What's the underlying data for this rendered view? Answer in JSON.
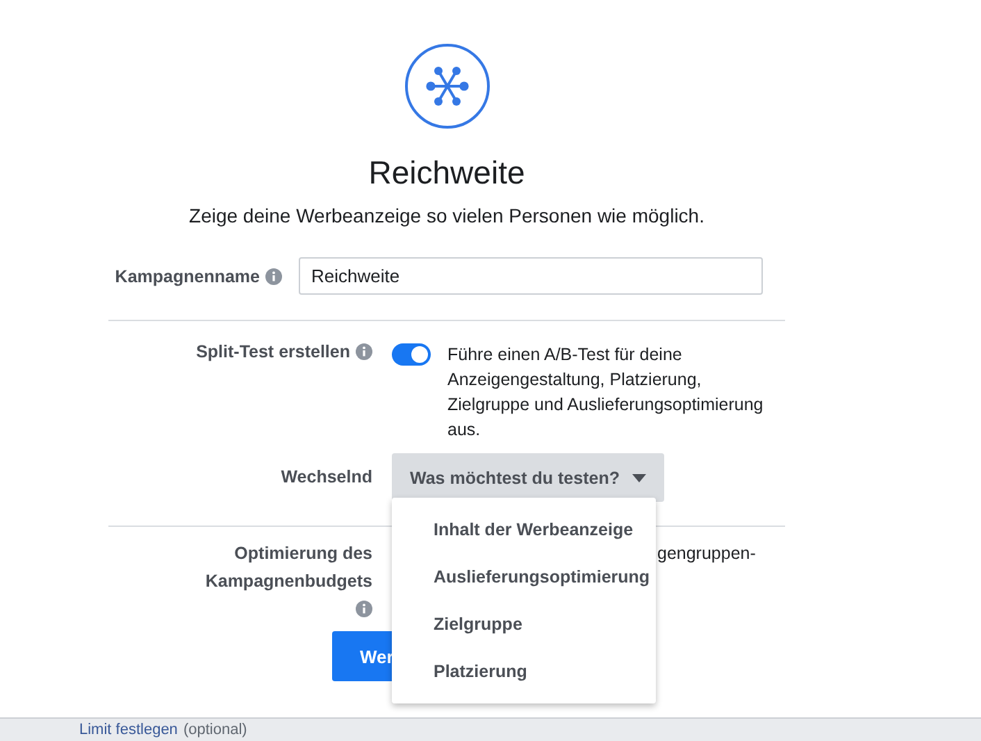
{
  "header": {
    "title": "Reichweite",
    "subtitle": "Zeige deine Werbeanzeige so vielen Personen wie möglich."
  },
  "campaign_name": {
    "label": "Kampagnenname",
    "value": "Reichweite"
  },
  "split_test": {
    "label": "Split-Test erstellen",
    "on": true,
    "description": "Führe einen A/B-Test für deine Anzeigengestaltung, Platzierung, Zielgruppe und Auslieferungsoptimierung aus."
  },
  "variable": {
    "label": "Wechselnd",
    "dropdown": "Was möchtest du testen?",
    "expanded": true,
    "options": [
      {
        "label": "Inhalt der Werbeanzeige"
      },
      {
        "label": "Auslieferungsoptimierung"
      },
      {
        "label": "Zielgruppe"
      },
      {
        "label": "Platzierung"
      }
    ]
  },
  "budget_optimization": {
    "label": "Optimierung des Kampagnenbudgets",
    "description": "gengruppen-",
    "button": "Wer"
  },
  "footer": {
    "link": "Limit festlegen",
    "note": "(optional)"
  }
}
